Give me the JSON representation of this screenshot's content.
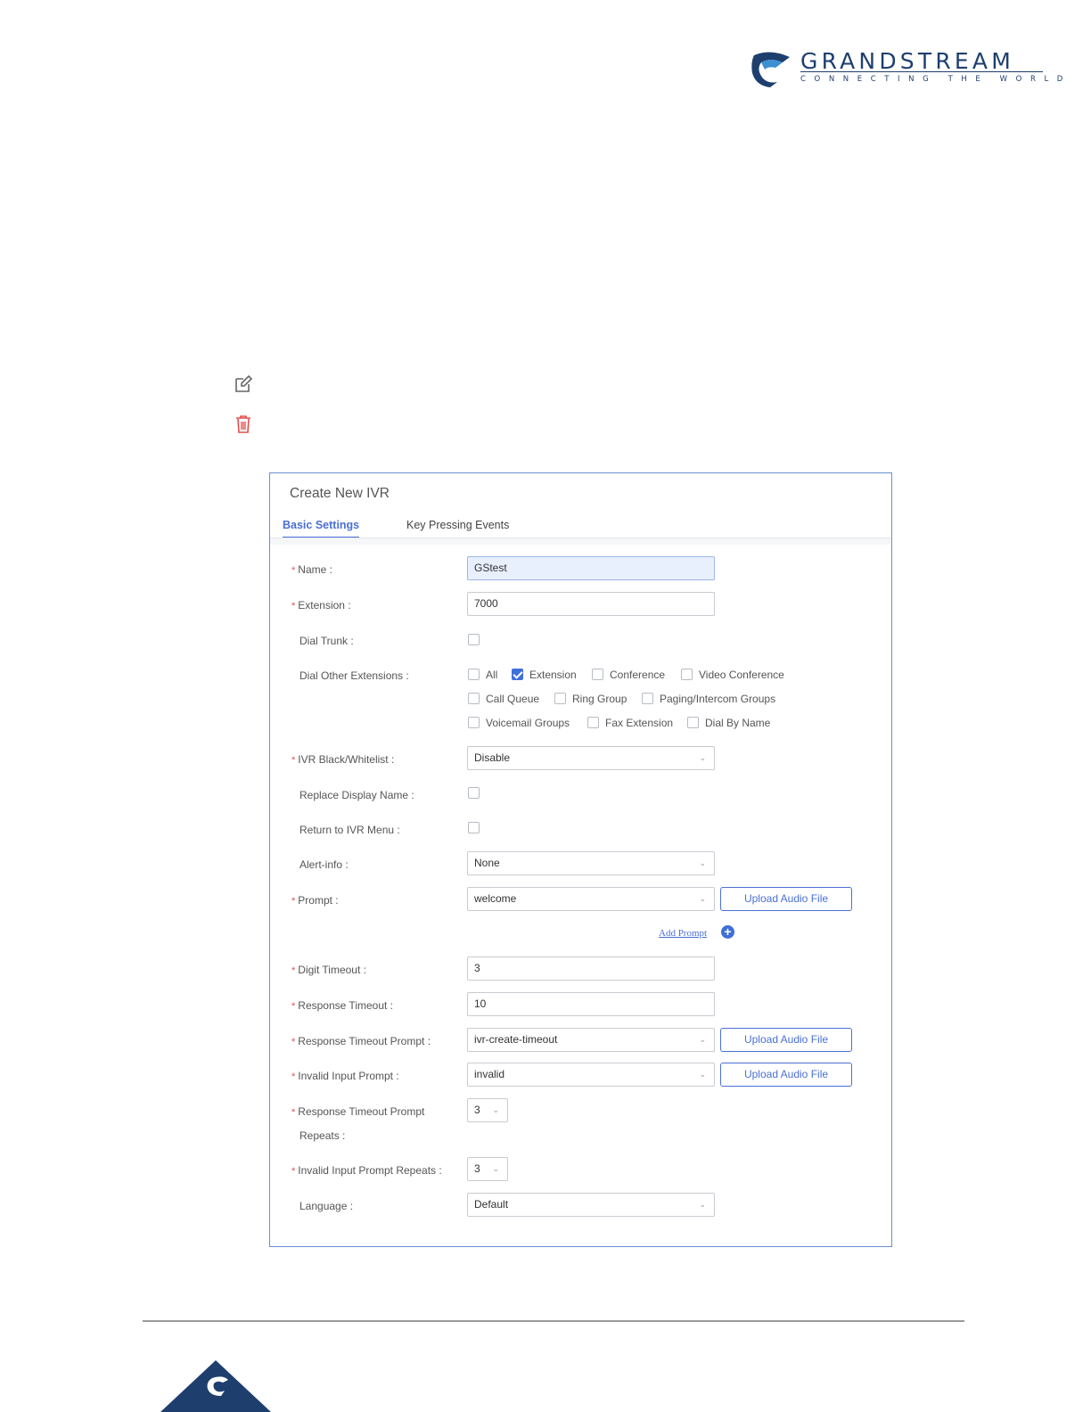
{
  "brand": {
    "name": "GRANDSTREAM",
    "tagline": "CONNECTING THE WORLD",
    "color": "#1e3f6e"
  },
  "page_icons": {
    "edit": "edit-icon",
    "delete": "trash-icon"
  },
  "dialog": {
    "title": "Create New IVR",
    "tabs": [
      {
        "label": "Basic Settings",
        "active": true
      },
      {
        "label": "Key Pressing Events",
        "active": false
      }
    ],
    "fields": {
      "name": {
        "label": "Name",
        "value": "GStest",
        "required": true
      },
      "extension": {
        "label": "Extension",
        "value": "7000",
        "required": true
      },
      "dial_trunk": {
        "label": "Dial Trunk",
        "checked": false
      },
      "dial_other_extensions": {
        "label": "Dial Other Extensions",
        "options": [
          {
            "label": "All",
            "checked": false
          },
          {
            "label": "Extension",
            "checked": true
          },
          {
            "label": "Conference",
            "checked": false
          },
          {
            "label": "Video Conference",
            "checked": false
          },
          {
            "label": "Call Queue",
            "checked": false
          },
          {
            "label": "Ring Group",
            "checked": false
          },
          {
            "label": "Paging/Intercom Groups",
            "checked": false
          },
          {
            "label": "Voicemail Groups",
            "checked": false
          },
          {
            "label": "Fax Extension",
            "checked": false
          },
          {
            "label": "Dial By Name",
            "checked": false
          }
        ]
      },
      "ivr_black_whitelist": {
        "label": "IVR Black/Whitelist",
        "value": "Disable",
        "required": true
      },
      "replace_display_name": {
        "label": "Replace Display Name",
        "checked": false
      },
      "return_to_ivr_menu": {
        "label": "Return to IVR Menu",
        "checked": false
      },
      "alert_info": {
        "label": "Alert-info",
        "value": "None"
      },
      "prompt": {
        "label": "Prompt",
        "value": "welcome",
        "required": true
      },
      "add_prompt": "Add Prompt",
      "digit_timeout": {
        "label": "Digit Timeout",
        "value": "3",
        "required": true
      },
      "response_timeout": {
        "label": "Response Timeout",
        "value": "10",
        "required": true
      },
      "response_timeout_prompt": {
        "label": "Response Timeout Prompt",
        "value": "ivr-create-timeout",
        "required": true
      },
      "invalid_input_prompt": {
        "label": "Invalid Input Prompt",
        "value": "invalid",
        "required": true
      },
      "response_timeout_prompt_repeats": {
        "label_line1": "Response Timeout Prompt",
        "label_line2": "Repeats",
        "value": "3",
        "required": true
      },
      "invalid_input_prompt_repeats": {
        "label": "Invalid Input Prompt Repeats",
        "value": "3",
        "required": true
      },
      "language": {
        "label": "Language",
        "value": "Default"
      }
    },
    "upload_label": "Upload Audio File",
    "accent_color": "#4a6fd6"
  }
}
